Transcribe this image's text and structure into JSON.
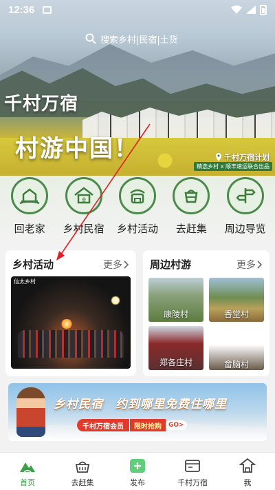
{
  "status_bar": {
    "time": "12:36"
  },
  "search": {
    "placeholder": "搜索乡村|民宿|土货"
  },
  "hero": {
    "slogan_line1": "千村万宿",
    "slogan_line2": "村游中国！",
    "plan_tag": "千村万宿计划",
    "plan_sub": "精选乡村 x 顺丰速运联合出品"
  },
  "categories": [
    {
      "label": "回老家",
      "icon": "home-village-icon"
    },
    {
      "label": "乡村民宿",
      "icon": "guesthouse-icon"
    },
    {
      "label": "乡村活动",
      "icon": "activity-icon"
    },
    {
      "label": "去赶集",
      "icon": "market-basket-icon"
    },
    {
      "label": "周边导览",
      "icon": "signpost-icon"
    }
  ],
  "activities_card": {
    "title": "乡村活动",
    "more": "更多",
    "image_watermark": "仙太乡村"
  },
  "villages_card": {
    "title": "周边村游",
    "more": "更多",
    "villages": [
      "康陵村",
      "香堂村",
      "郑各庄村",
      "畲脑村"
    ]
  },
  "banner": {
    "headline": "乡村民宿　约到哪里免费住哪里",
    "member_label": "千村万宿会员",
    "promo_label": "限时抢购",
    "go_label": "GO>"
  },
  "bottom_nav": [
    {
      "label": "首页",
      "active": true
    },
    {
      "label": "去赶集",
      "active": false
    },
    {
      "label": "发布",
      "active": false
    },
    {
      "label": "千村万宿",
      "active": false
    },
    {
      "label": "我",
      "active": false
    }
  ],
  "colors": {
    "brand_green": "#3aa14a",
    "accent_red": "#e23a2a",
    "annotation_red": "#e02020"
  }
}
